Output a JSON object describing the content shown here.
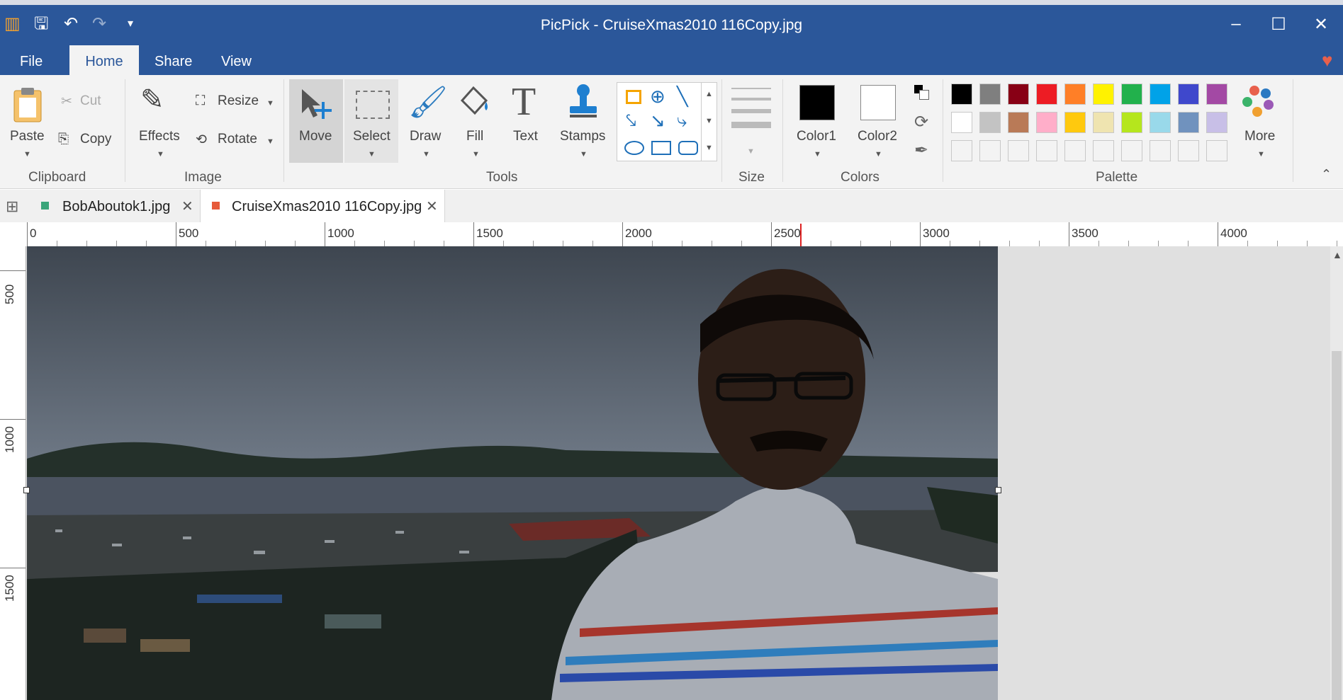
{
  "title": "PicPick - CruiseXmas2010 116Copy.jpg",
  "menu": {
    "file": "File",
    "home": "Home",
    "share": "Share",
    "view": "View"
  },
  "ribbon": {
    "paste": "Paste",
    "cut": "Cut",
    "copy": "Copy",
    "effects": "Effects",
    "resize": "Resize",
    "rotate": "Rotate",
    "move": "Move",
    "select": "Select",
    "draw": "Draw",
    "fill": "Fill",
    "text": "Text",
    "stamps": "Stamps",
    "color1": "Color1",
    "color2": "Color2",
    "more": "More",
    "groups": {
      "clipboard": "Clipboard",
      "image": "Image",
      "tools": "Tools",
      "size": "Size",
      "colors": "Colors",
      "palette": "Palette"
    }
  },
  "tabs": [
    {
      "label": "BobAboutok1.jpg"
    },
    {
      "label": "CruiseXmas2010 116Copy.jpg"
    }
  ],
  "ruler": {
    "h": [
      "0",
      "500",
      "1000",
      "1500",
      "2000",
      "2500",
      "3000",
      "3500",
      "4000"
    ],
    "v": [
      "500",
      "1000",
      "1500"
    ]
  },
  "palette": {
    "row1": [
      "#000000",
      "#7f7f7f",
      "#880015",
      "#ed1c24",
      "#ff7f27",
      "#fff200",
      "#22b14c",
      "#00a2e8",
      "#3f48cc",
      "#a349a4"
    ],
    "row2": [
      "#ffffff",
      "#c3c3c3",
      "#b97a57",
      "#ffaec9",
      "#ffc90e",
      "#efe4b0",
      "#b5e61d",
      "#99d9ea",
      "#7092be",
      "#c8bfe7"
    ]
  },
  "colors": {
    "color1": "#000000",
    "color2": "#ffffff",
    "accent": "#2b579a"
  }
}
